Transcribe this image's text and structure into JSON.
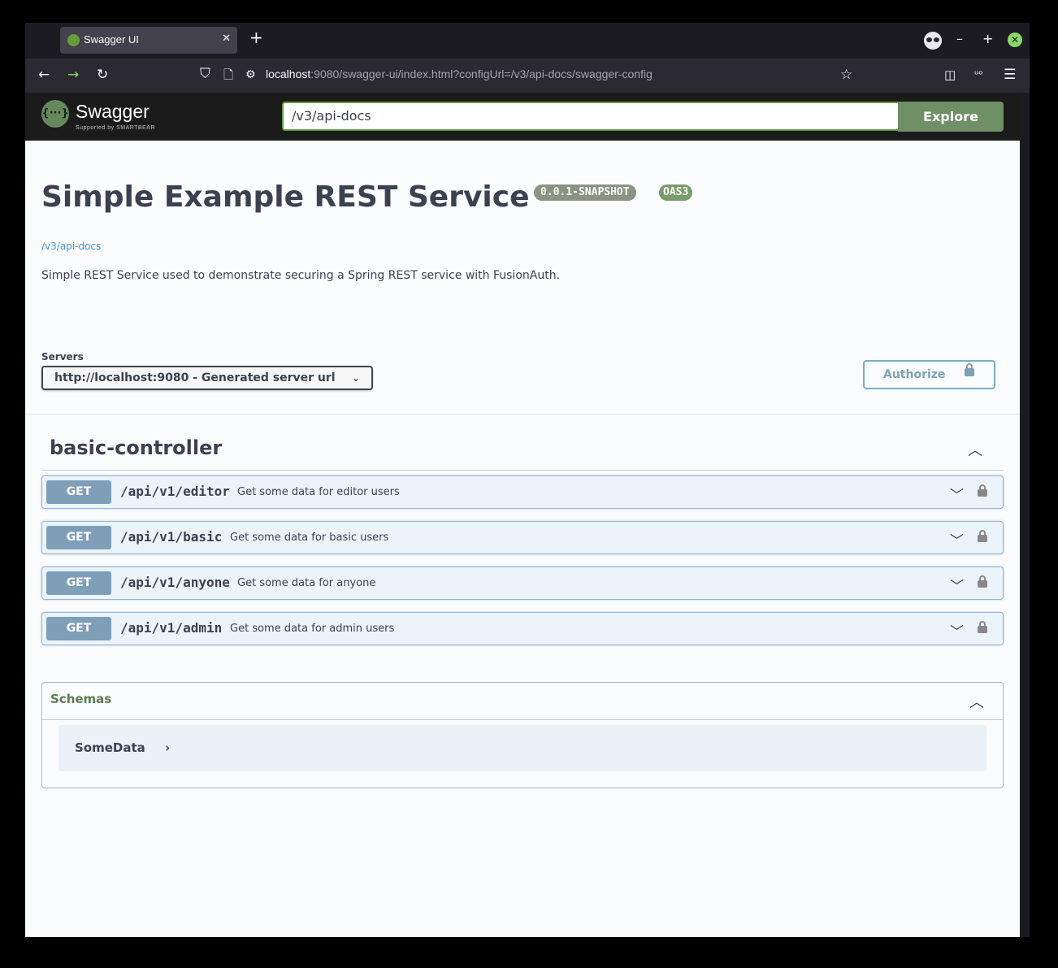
{
  "browser": {
    "tab_title": "Swagger UI",
    "tab_close": "✕",
    "new_tab": "+",
    "window_min": "–",
    "window_max": "+",
    "window_close": "✕",
    "url_host": "localhost",
    "url_rest": ":9080/swagger-ui/index.html?configUrl=/v3/api-docs/swagger-config",
    "icons": {
      "back": "←",
      "forward": "→",
      "reload": "↻",
      "shield": "⛉",
      "page": "🗋",
      "permissions": "⚙",
      "star": "☆",
      "pocket": "◫",
      "ublock": "ᵘᵒ",
      "menu": "☰"
    }
  },
  "topbar": {
    "logo_mark": "{···}",
    "logo_text": "Swagger",
    "logo_sub": "Supported by SMARTBEAR",
    "spec_url": "/v3/api-docs",
    "explore_label": "Explore"
  },
  "info": {
    "title": "Simple Example REST Service",
    "version_badge": "0.0.1-SNAPSHOT",
    "oas_badge": "OAS3",
    "spec_link": "/v3/api-docs",
    "description": "Simple REST Service used to demonstrate securing a Spring REST service with FusionAuth."
  },
  "servers": {
    "label": "Servers",
    "selected": "http://localhost:9080 - Generated server url",
    "chevron": "⌄"
  },
  "authorize": {
    "label": "Authorize"
  },
  "tag": {
    "name": "basic-controller",
    "toggle": "︿"
  },
  "operations": [
    {
      "method": "GET",
      "path": "/api/v1/editor",
      "summary": "Get some data for editor users",
      "chevron": "﹀"
    },
    {
      "method": "GET",
      "path": "/api/v1/basic",
      "summary": "Get some data for basic users",
      "chevron": "﹀"
    },
    {
      "method": "GET",
      "path": "/api/v1/anyone",
      "summary": "Get some data for anyone",
      "chevron": "﹀"
    },
    {
      "method": "GET",
      "path": "/api/v1/admin",
      "summary": "Get some data for admin users",
      "chevron": "﹀"
    }
  ],
  "schemas": {
    "title": "Schemas",
    "toggle": "︿",
    "models": [
      {
        "name": "SomeData",
        "arrow": "›"
      }
    ]
  }
}
